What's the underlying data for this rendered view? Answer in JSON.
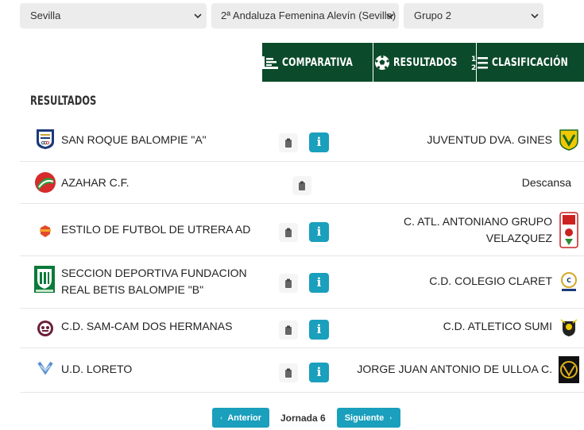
{
  "filters": {
    "province": "Sevilla",
    "competition": "2ª Andaluza Femenina Alevín (Sevilla)",
    "group": "Grupo 2"
  },
  "tabs": {
    "comparativa": "COMPARATIVA",
    "resultados": "RESULTADOS",
    "clasificacion": "CLASIFICACIÓN"
  },
  "section_title": "RESULTADOS",
  "matches": [
    {
      "home": "SAN ROQUE BALOMPIE \"A\"",
      "away": "JUVENTUD DVA. GINES"
    },
    {
      "home": "AZAHAR C.F.",
      "away": "Descansa"
    },
    {
      "home": "ESTILO DE FUTBOL DE UTRERA AD",
      "away": "C. ATL. ANTONIANO GRUPO VELAZQUEZ"
    },
    {
      "home": "SECCION DEPORTIVA FUNDACION REAL BETIS BALOMPIE \"B\"",
      "away": "C.D. COLEGIO CLARET"
    },
    {
      "home": "C.D. SAM-CAM DOS HERMANAS",
      "away": "C.D. ATLETICO SUMI"
    },
    {
      "home": "U.D. LORETO",
      "away": "JORGE JUAN ANTONIO DE ULLOA C."
    }
  ],
  "info_label": "i",
  "pager": {
    "prev": "Anterior",
    "round": "Jornada 6",
    "next": "Siguiente"
  },
  "colors": {
    "tab_bg": "#0b4a2a",
    "button_teal": "#1a9fbd",
    "select_bg": "#ececec"
  }
}
